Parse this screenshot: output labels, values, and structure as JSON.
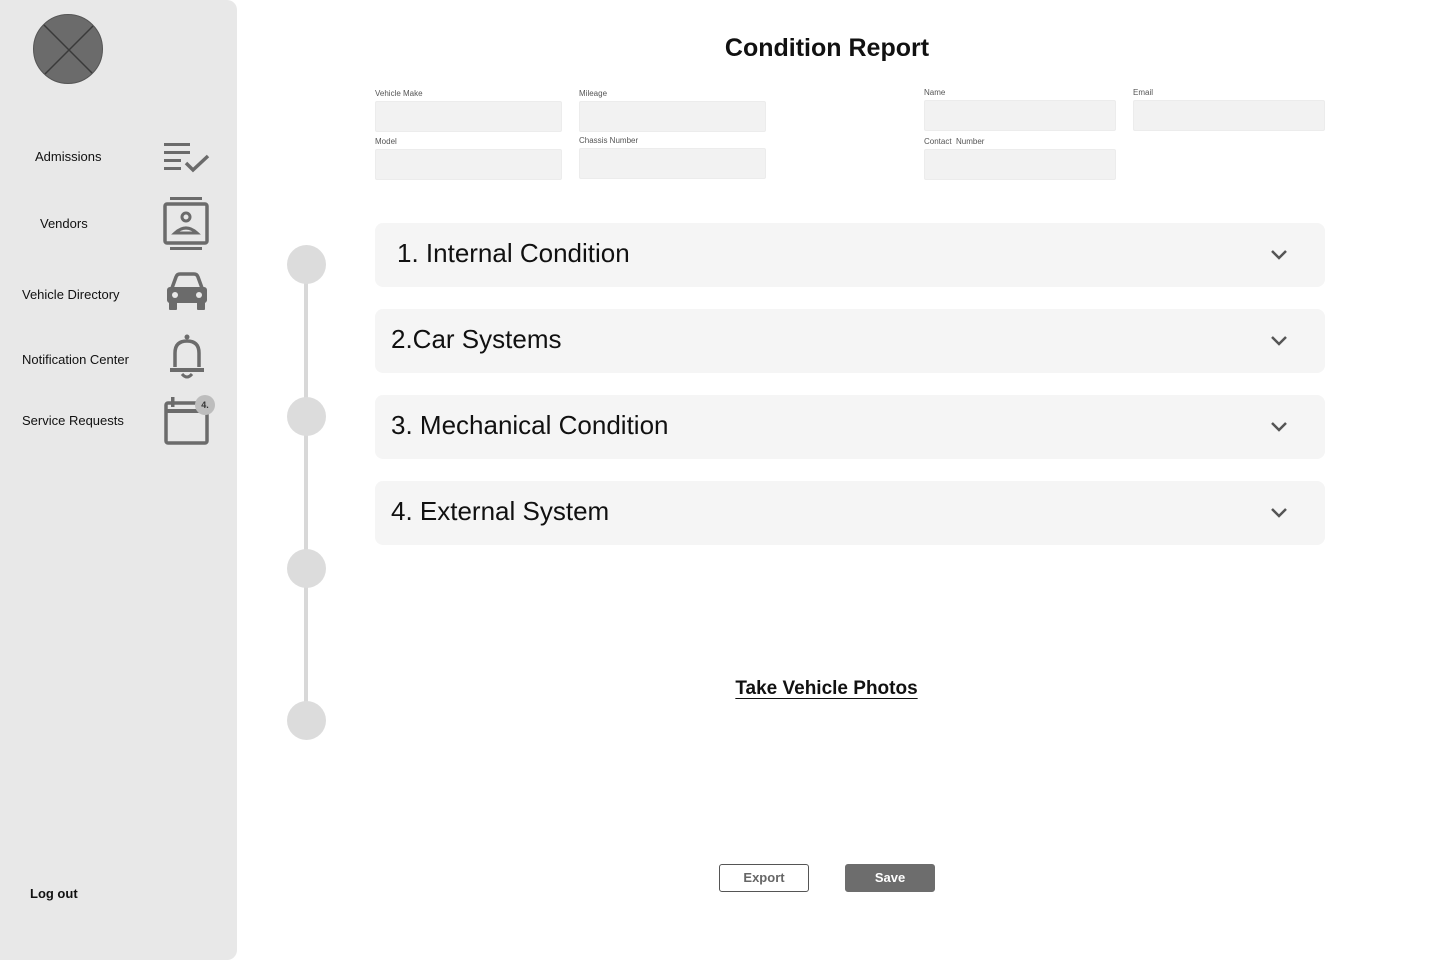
{
  "sidebar": {
    "logo_icon": "placeholder-x-icon",
    "items": [
      {
        "label": "Admissions",
        "icon": "checklist-icon"
      },
      {
        "label": "Vendors",
        "icon": "contact-card-icon"
      },
      {
        "label": "Vehicle Directory",
        "icon": "car-icon"
      },
      {
        "label": "Notification Center",
        "icon": "bell-icon"
      },
      {
        "label": "Service Requests",
        "icon": "calendar-icon",
        "badge": "4."
      }
    ],
    "logout_label": "Log out"
  },
  "main": {
    "title": "Condition Report",
    "vehicle_fields": [
      {
        "label": "Vehicle Make",
        "value": ""
      },
      {
        "label": "Mileage",
        "value": ""
      },
      {
        "label": "Model",
        "value": ""
      },
      {
        "label": "Chassis Number",
        "value": ""
      }
    ],
    "contact_fields": [
      {
        "label": "Name",
        "value": ""
      },
      {
        "label": "Email",
        "value": ""
      },
      {
        "label": "Contact  Number",
        "value": ""
      }
    ],
    "sections": [
      {
        "title": "1. Internal Condition"
      },
      {
        "title": "2.Car Systems"
      },
      {
        "title": "3. Mechanical Condition"
      },
      {
        "title": "4. External System"
      }
    ],
    "photos_link": "Take Vehicle Photos",
    "export_label": "Export",
    "save_label": "Save"
  },
  "colors": {
    "sidebar_bg": "#e8e8e8",
    "input_bg": "#f2f2f2",
    "accordion_bg": "#f5f5f5",
    "icon_gray": "#6b6b6b",
    "save_button_bg": "#6d6d6d"
  }
}
